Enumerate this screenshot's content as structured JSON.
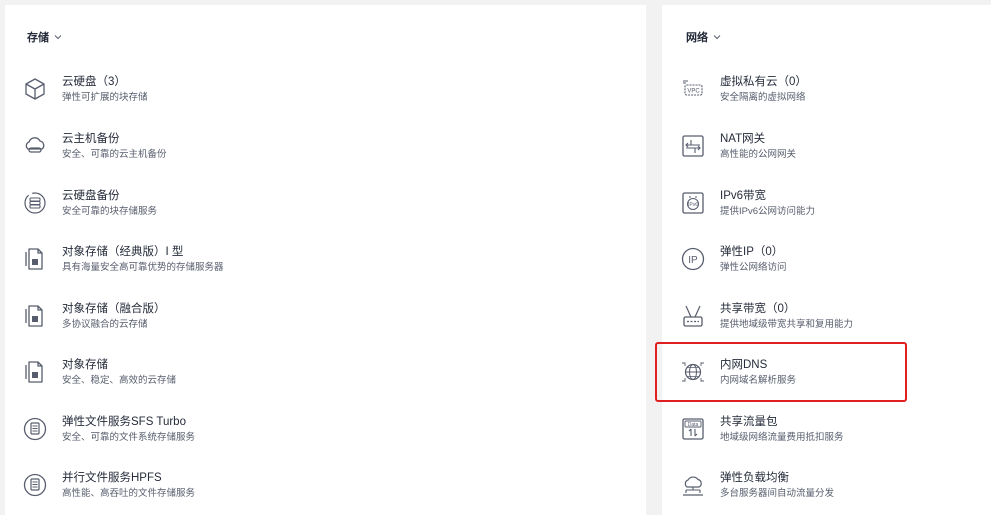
{
  "storage": {
    "header": "存储",
    "items": [
      {
        "title": "云硬盘（3）",
        "desc": "弹性可扩展的块存储",
        "icon": "cube-icon"
      },
      {
        "title": "云主机备份",
        "desc": "安全、可靠的云主机备份",
        "icon": "cloud-disk-icon"
      },
      {
        "title": "云硬盘备份",
        "desc": "安全可靠的块存储服务",
        "icon": "disk-backup-icon"
      },
      {
        "title": "对象存储（经典版）I 型",
        "desc": "具有海量安全高可靠优势的存储服务器",
        "icon": "object-storage-icon"
      },
      {
        "title": "对象存储（融合版）",
        "desc": "多协议融合的云存储",
        "icon": "object-storage-icon"
      },
      {
        "title": "对象存储",
        "desc": "安全、稳定、高效的云存储",
        "icon": "object-storage-icon"
      },
      {
        "title": "弹性文件服务SFS Turbo",
        "desc": "安全、可靠的文件系统存储服务",
        "icon": "file-service-icon"
      },
      {
        "title": "并行文件服务HPFS",
        "desc": "高性能、高吞吐的文件存储服务",
        "icon": "file-service-icon"
      }
    ]
  },
  "network": {
    "header": "网络",
    "items": [
      {
        "title": "虚拟私有云（0）",
        "desc": "安全隔离的虚拟网络",
        "icon": "vpc-icon",
        "icon_text": "VPC"
      },
      {
        "title": "NAT网关",
        "desc": "高性能的公网网关",
        "icon": "nat-gateway-icon"
      },
      {
        "title": "IPv6带宽",
        "desc": "提供IPv6公网访问能力",
        "icon": "ipv6-bandwidth-icon",
        "icon_text": "IPv6"
      },
      {
        "title": "弹性IP（0）",
        "desc": "弹性公网络访问",
        "icon": "elastic-ip-icon",
        "icon_text": "IP"
      },
      {
        "title": "共享带宽（0）",
        "desc": "提供地域级带宽共享和复用能力",
        "icon": "shared-bandwidth-icon"
      },
      {
        "title": "内网DNS",
        "desc": "内网域名解析服务",
        "icon": "globe-dns-icon"
      },
      {
        "title": "共享流量包",
        "desc": "地域级网络流量费用抵扣服务",
        "icon": "data-package-icon",
        "icon_text": "Data"
      },
      {
        "title": "弹性负载均衡",
        "desc": "多台服务器间自动流量分发",
        "icon": "load-balancer-icon"
      }
    ]
  },
  "colors": {
    "title": "#252b3a",
    "desc": "#575d6c",
    "icon": "#575d6c",
    "highlight": "#e02020",
    "background": "#f2f2f2"
  }
}
